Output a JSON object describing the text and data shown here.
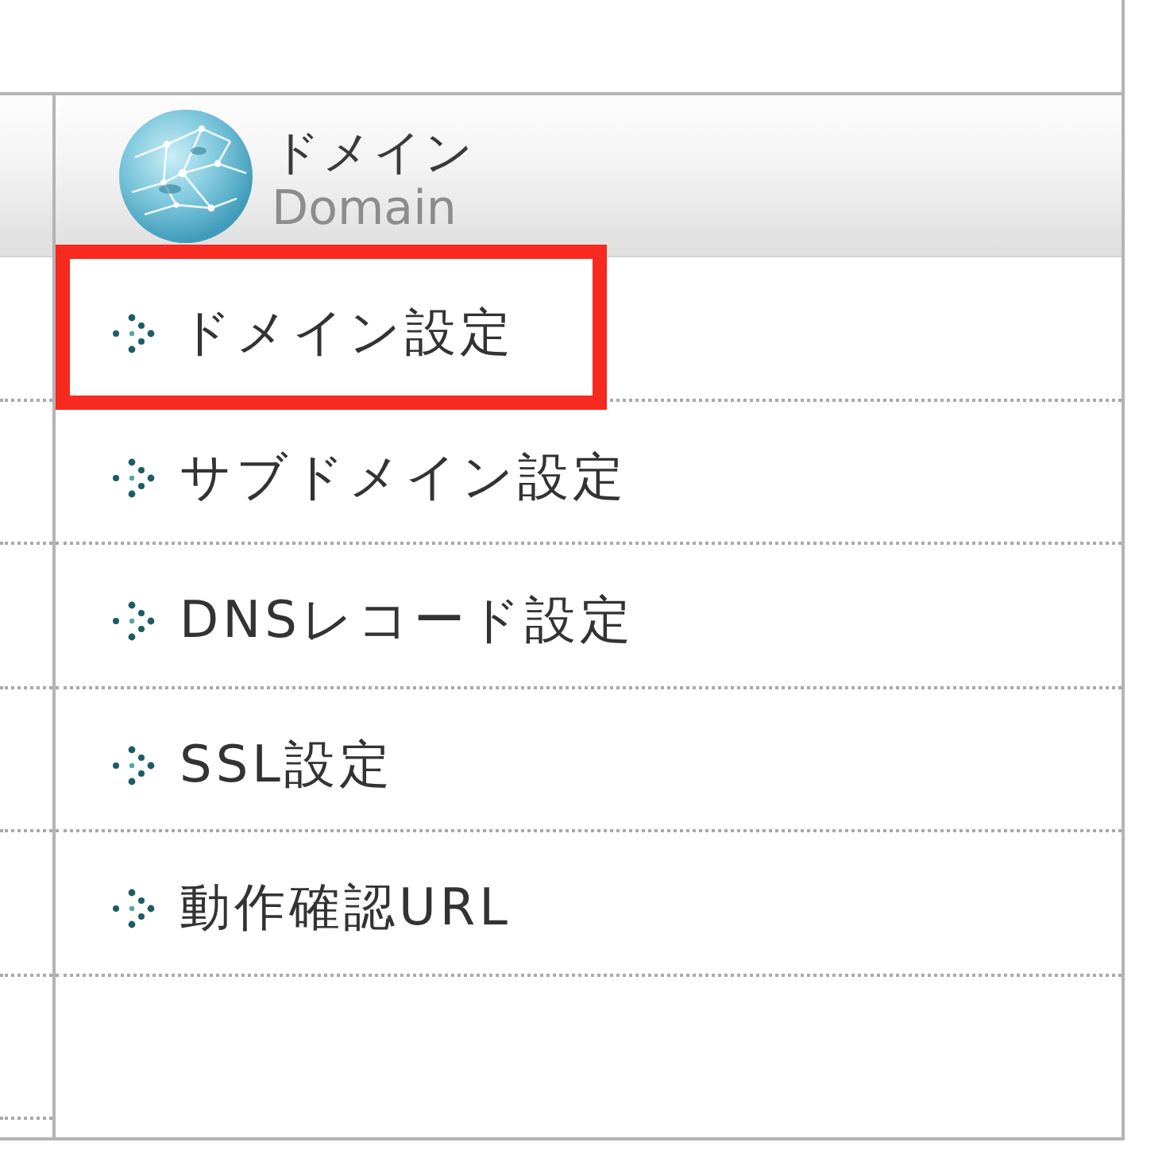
{
  "header": {
    "title": "ドメイン",
    "subtitle": "Domain"
  },
  "menu": {
    "items": [
      {
        "label": "ドメイン設定",
        "highlighted": true
      },
      {
        "label": "サブドメイン設定",
        "highlighted": false
      },
      {
        "label": "DNSレコード設定",
        "highlighted": false
      },
      {
        "label": "SSL設定",
        "highlighted": false
      },
      {
        "label": "動作確認URL",
        "highlighted": false
      }
    ]
  }
}
